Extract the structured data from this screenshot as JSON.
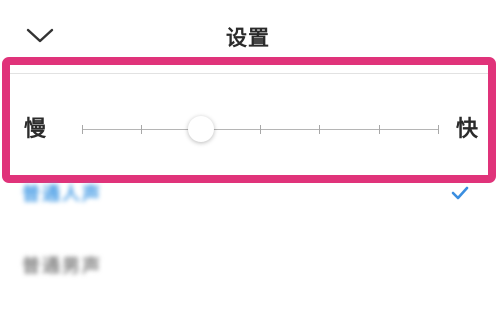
{
  "header": {
    "title": "设置",
    "back_icon": "chevron-down-icon"
  },
  "speed": {
    "slow_label": "慢",
    "fast_label": "快",
    "steps": 7,
    "current_step": 2
  },
  "list": {
    "items": [
      {
        "label": "普通人声",
        "selected": true,
        "color": "#4a9ee6"
      },
      {
        "label": "普通男声",
        "selected": false,
        "color": "#888888"
      }
    ]
  },
  "colors": {
    "highlight": "#e0337a",
    "accent": "#3a8ee0"
  }
}
